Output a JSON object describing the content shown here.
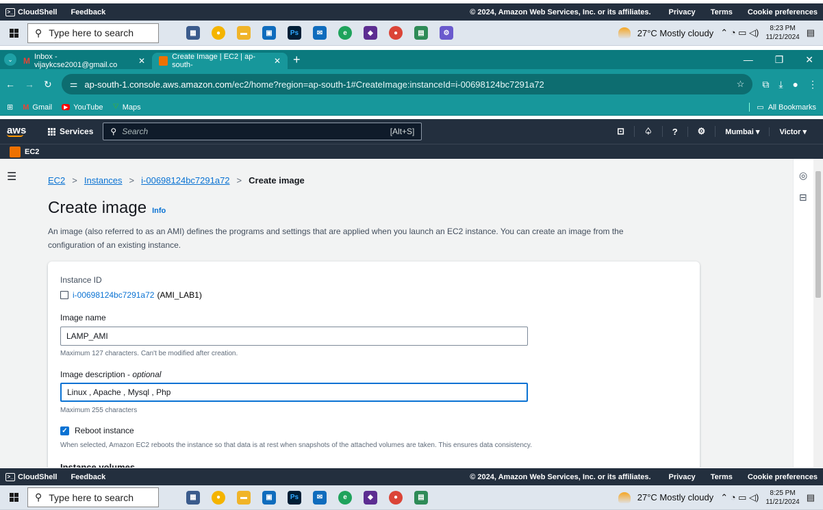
{
  "aws_footer": {
    "cloudshell": "CloudShell",
    "feedback": "Feedback",
    "copyright": "© 2024, Amazon Web Services, Inc. or its affiliates.",
    "privacy": "Privacy",
    "terms": "Terms",
    "cookies": "Cookie preferences"
  },
  "taskbar_top": {
    "search_placeholder": "Type here to search",
    "weather": "27°C  Mostly cloudy",
    "time": "8:23 PM",
    "date": "11/21/2024"
  },
  "taskbar_bottom": {
    "search_placeholder": "Type here to search",
    "weather": "27°C  Mostly cloudy",
    "time": "8:25 PM",
    "date": "11/21/2024"
  },
  "browser": {
    "tabs": [
      {
        "label": "Inbox - vijaykcse2001@gmail.co",
        "active": false
      },
      {
        "label": "Create Image | EC2 | ap-south-",
        "active": true
      }
    ],
    "new_tab": "+",
    "url_host": "ap-south-1.console.aws.amazon.com",
    "url_path": "/ec2/home?region=ap-south-1#CreateImage:instanceId=i-00698124bc7291a72",
    "bookmarks": [
      "Gmail",
      "YouTube",
      "Maps"
    ],
    "all_bookmarks": "All Bookmarks"
  },
  "aws_nav": {
    "logo": "aws",
    "services": "Services",
    "search_placeholder": "Search",
    "search_shortcut": "[Alt+S]",
    "region": "Mumbai ▾",
    "user": "Victor ▾",
    "service_name": "EC2"
  },
  "breadcrumb": {
    "items": [
      "EC2",
      "Instances",
      "i-00698124bc7291a72"
    ],
    "current": "Create image"
  },
  "page": {
    "title": "Create image",
    "info": "Info",
    "intro": "An image (also referred to as an AMI) defines the programs and settings that are applied when you launch an EC2 instance. You can create an image from the configuration of an existing instance."
  },
  "form": {
    "instance_id_label": "Instance ID",
    "instance_id": "i-00698124bc7291a72",
    "instance_name": "(AMI_LAB1)",
    "image_name_label": "Image name",
    "image_name_value": "LAMP_AMI",
    "image_name_hint": "Maximum 127 characters. Can't be modified after creation.",
    "desc_label": "Image description - ",
    "desc_optional": "optional",
    "desc_value": "Linux , Apache , Mysql , Php",
    "desc_hint": "Maximum 255 characters",
    "reboot_label": "Reboot instance",
    "reboot_checked": true,
    "reboot_hint": "When selected, Amazon EC2 reboots the instance so that data is at rest when snapshots of the attached volumes are taken. This ensures data consistency.",
    "next_section": "Instance volumes"
  }
}
